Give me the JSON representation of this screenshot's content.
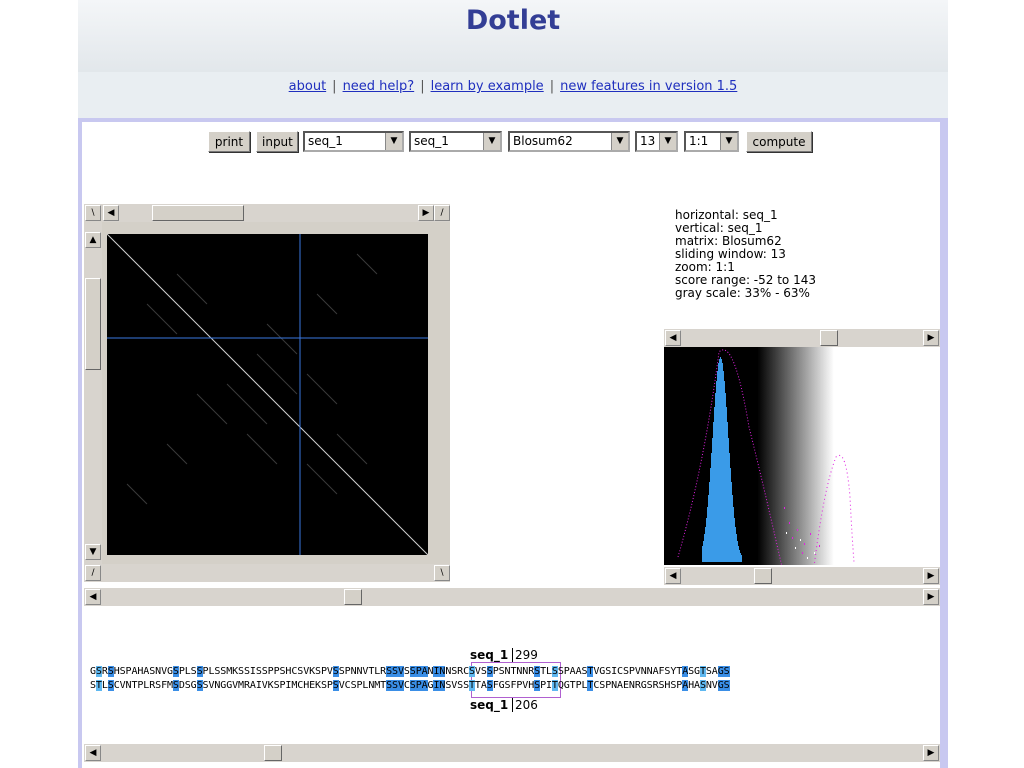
{
  "header": {
    "title": "Dotlet"
  },
  "nav": {
    "about": "about",
    "help": "need help?",
    "example": "learn by example",
    "features": "new features in version 1.5",
    "sep": "|"
  },
  "toolbar": {
    "print": "print",
    "input": "input",
    "seq_h": "seq_1",
    "seq_v": "seq_1",
    "matrix": "Blosum62",
    "window": "13",
    "zoom": "1:1",
    "compute": "compute"
  },
  "corners": {
    "tl": "\\",
    "tr": "/",
    "bl": "/",
    "br": "\\"
  },
  "info": {
    "horizontal": "horizontal: seq_1",
    "vertical": "vertical: seq_1",
    "matrix": "matrix: Blosum62",
    "window": "sliding window: 13",
    "zoom": "zoom: 1:1",
    "range": "score range: -52 to 143",
    "gray": "gray scale: 33% - 63%"
  },
  "alignment": {
    "top_label": "seq_1",
    "top_pos": "299",
    "bottom_label": "seq_1",
    "bottom_pos": "206",
    "top_seq": "GSRSHSPAHASNVGSPLSSPLSSMKSSISSPPSHCSVKSPVSSPNNVTLRSSVSSPANINNSRCSVSSPSNTNNRSTLSSPAASTVGSICSPVNNAFSYTASGTSAGS",
    "bottom_seq": "STLSCVNTPLRSFMSDSGSSVNGGVMRAIVKSPIMCHEKSPSVCSPLNMTSSVCSPAGINSVSSTTASFGSFPVHSPITQGTPLTCSPNAENRGSRSHSPAHASNVGS"
  },
  "colors": {
    "accent": "#333e95",
    "link": "#1f2fbe",
    "frame": "#c8c8f0",
    "hist": "#3a9be8",
    "curve": "#e020e0",
    "crosshair": "#3a78e0"
  }
}
